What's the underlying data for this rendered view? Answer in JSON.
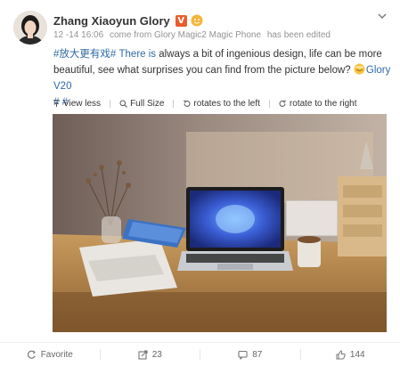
{
  "post": {
    "author": "Zhang Xiaoyun Glory",
    "vip_badge": "V",
    "time": "12 -14 16:06",
    "source": "come from Glory Magic2 Magic Phone",
    "edited": "has been edited",
    "hashtag1": "#放大更有戏#",
    "text_blue": "There is",
    "text_main": " always a bit of ingenious design, life can be more beautiful, see what surprises you can find from the picture below?",
    "link_text": "Glory V20",
    "hashtag2": "# #"
  },
  "media_bar": {
    "view_less": "View less",
    "full_size": "Full Size",
    "rotate_left": "rotates to the left",
    "rotate_right": "rotate to the right"
  },
  "footer": {
    "favorite": "Favorite",
    "reposts": "23",
    "comments": "87",
    "likes": "144"
  },
  "colors": {
    "link": "#2d6aa6",
    "badge": "#e95d2c",
    "muted": "#939393"
  }
}
